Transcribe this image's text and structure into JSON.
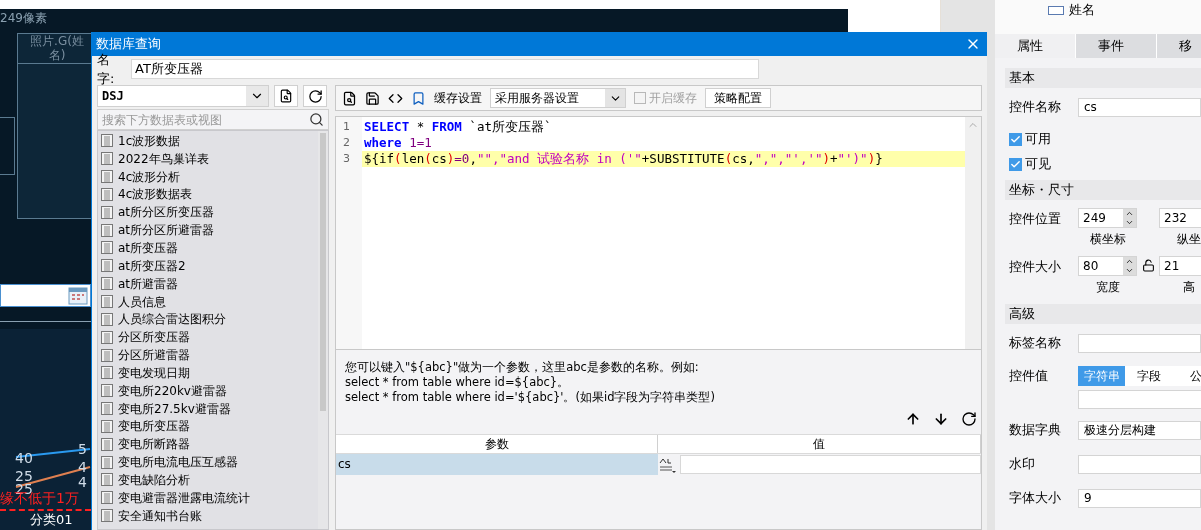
{
  "canvas": {
    "ruler_text": "249像素",
    "header_cell": [
      "照片.G(姓",
      "名)"
    ],
    "value_labels": [
      "40",
      "25",
      "25",
      "5",
      "4",
      "4"
    ],
    "warning_text": "缘不低于1万",
    "axis_label": "分类01"
  },
  "dialog": {
    "title": "数据库查询",
    "name_label": "名字:",
    "name_value": "AT所变压器",
    "datasource": "DSJ",
    "search_placeholder": "搜索下方数据表或视图",
    "tables": [
      "1c波形数据",
      "2022年鸟巢详表",
      "4c波形分析",
      "4c波形数据表",
      "at所分区所变压器",
      "at所分区所避雷器",
      "at所变压器",
      "at所变压器2",
      "at所避雷器",
      "人员信息",
      "人员综合雷达图积分",
      "分区所变压器",
      "分区所避雷器",
      "变电发现日期",
      "变电所220kv避雷器",
      "变电所27.5kv避雷器",
      "变电所变压器",
      "变电所断路器",
      "变电所电流电压互感器",
      "变电缺陷分析",
      "变电避雷器泄露电流统计",
      "安全通知书台账"
    ],
    "toolbar": {
      "cache_label": "缓存设置",
      "cache_mode": "采用服务器设置",
      "enable_cache": {
        "label": "开启缓存",
        "checked": false,
        "disabled": true
      },
      "strategy_button": "策略配置"
    },
    "sql_lines": [
      {
        "number": "1",
        "current": false,
        "tokens": [
          {
            "kind": "keyword",
            "text": "SELECT"
          },
          {
            "kind": "plain",
            "text": " * "
          },
          {
            "kind": "keyword",
            "text": "FROM"
          },
          {
            "kind": "plain",
            "text": " `at所变压器`"
          }
        ]
      },
      {
        "number": "2",
        "current": false,
        "tokens": [
          {
            "kind": "keyword",
            "text": "where"
          },
          {
            "kind": "number",
            "text": " 1=1"
          }
        ]
      },
      {
        "number": "3",
        "current": true,
        "tokens": [
          {
            "kind": "plain",
            "text": "${if"
          },
          {
            "kind": "paren",
            "text": "("
          },
          {
            "kind": "plain",
            "text": "len"
          },
          {
            "kind": "paren",
            "text": "("
          },
          {
            "kind": "plain",
            "text": "cs"
          },
          {
            "kind": "paren",
            "text": ")"
          },
          {
            "kind": "number",
            "text": "=0"
          },
          {
            "kind": "plain",
            "text": ","
          },
          {
            "kind": "string",
            "text": "\"\",\"and 试验名称 in ('\""
          },
          {
            "kind": "plain",
            "text": "+SUBSTITUTE"
          },
          {
            "kind": "paren",
            "text": "("
          },
          {
            "kind": "plain",
            "text": "cs,"
          },
          {
            "kind": "string",
            "text": "\",\",\"','\""
          },
          {
            "kind": "paren",
            "text": ")"
          },
          {
            "kind": "plain",
            "text": "+"
          },
          {
            "kind": "string",
            "text": "\"')\""
          },
          {
            "kind": "paren",
            "text": ")"
          },
          {
            "kind": "plain",
            "text": "}"
          }
        ]
      }
    ],
    "help_lines": [
      "您可以键入\"${abc}\"做为一个参数，这里abc是参数的名称。例如:",
      "select * from table where id=${abc}。",
      "select * from table where id='${abc}'。(如果id字段为字符串类型)"
    ],
    "params": {
      "columns": [
        "参数",
        "值"
      ],
      "rows": [
        {
          "name": "cs",
          "selected": true
        }
      ]
    }
  },
  "properties": {
    "tree_items": [
      "姓名"
    ],
    "tabs": [
      {
        "label": "属性",
        "selected": true
      },
      {
        "label": "事件",
        "selected": false
      },
      {
        "label": "移",
        "selected": false
      }
    ],
    "sections": [
      {
        "title": "基本",
        "rows": [
          {
            "kind": "text",
            "label": "控件名称",
            "value": "cs"
          },
          {
            "kind": "checkbox",
            "label": "可用",
            "checked": true
          },
          {
            "kind": "checkbox",
            "label": "可见",
            "checked": true
          }
        ]
      },
      {
        "title": "坐标・尺寸",
        "rows": [
          {
            "kind": "pair",
            "label": "控件位置",
            "fields": [
              {
                "value": "249",
                "caption": "横坐标"
              },
              {
                "value": "232",
                "caption": "纵坐"
              }
            ]
          },
          {
            "kind": "pair",
            "label": "控件大小",
            "locked": false,
            "fields": [
              {
                "value": "80",
                "caption": "宽度"
              },
              {
                "value": "21",
                "caption": "高"
              }
            ]
          }
        ]
      },
      {
        "title": "高级",
        "rows": [
          {
            "kind": "text",
            "label": "标签名称"
          },
          {
            "kind": "segmented",
            "label": "控件值",
            "options": [
              {
                "label": "字符串",
                "selected": true
              },
              {
                "label": "字段",
                "selected": false
              },
              {
                "label": "公",
                "selected": false
              }
            ]
          },
          {
            "kind": "text",
            "label": "数据字典",
            "value": "极速分层构建"
          },
          {
            "kind": "text",
            "label": "水印"
          },
          {
            "kind": "text",
            "label": "字体大小",
            "value": "9"
          }
        ]
      }
    ]
  }
}
